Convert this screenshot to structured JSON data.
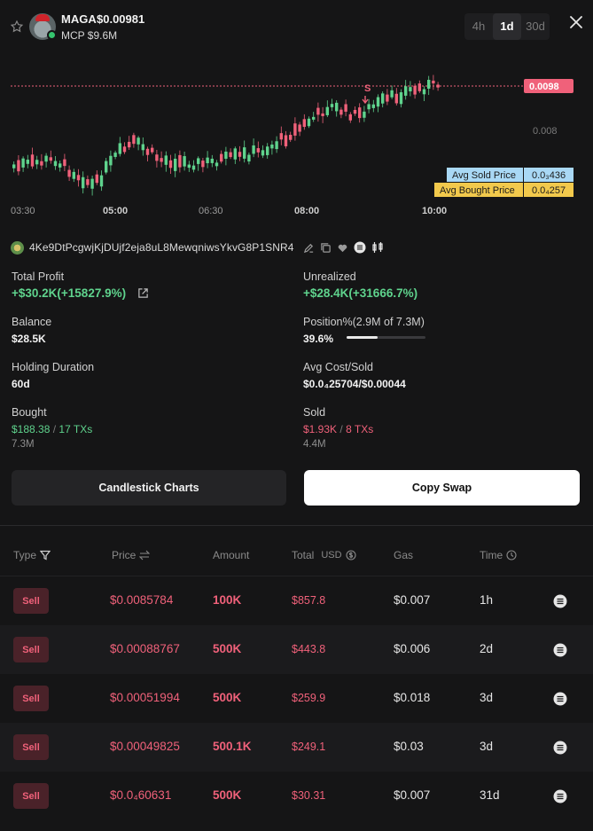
{
  "header": {
    "token_name": "MAGA",
    "token_price": "$0.00981",
    "mcp": "MCP $9.6M",
    "timeframes": [
      "4h",
      "1d",
      "30d"
    ],
    "active_timeframe": "1d"
  },
  "chart": {
    "price_tag": "0.0098",
    "axis_label": "0.008",
    "x_ticks": [
      "03:30",
      "05:00",
      "06:30",
      "08:00",
      "10:00"
    ],
    "marker_label": "S",
    "avg_sold_label": "Avg Sold Price",
    "avg_sold_value": "0.0₃436",
    "avg_bought_label": "Avg Bought Price",
    "avg_bought_value": "0.0₄257",
    "colors": {
      "up": "#5fd38d",
      "down": "#f0617a",
      "avg_sold_bg": "#a9d8f5",
      "avg_bought_bg": "#f2c94c",
      "price_line": "#f0617a"
    }
  },
  "wallet": {
    "address": "4Ke9DtPcgwjKjDUjf2eja8uL8MewqniwsYkvG8P1SNR4",
    "icons": [
      "edit-icon",
      "copy-icon",
      "heart-icon",
      "solscan-icon",
      "candles-icon"
    ]
  },
  "stats": {
    "total_profit_label": "Total Profit",
    "total_profit_value": "+$30.2K(+15827.9%)",
    "unrealized_label": "Unrealized",
    "unrealized_value": "+$28.4K(+31666.7%)",
    "balance_label": "Balance",
    "balance_value": "$28.5K",
    "position_label": "Position%(2.9M of 7.3M)",
    "position_value": "39.6%",
    "position_fraction": 0.396,
    "holding_label": "Holding Duration",
    "holding_value": "60d",
    "avg_cost_label": "Avg Cost/Sold",
    "avg_cost_value": "$0.0₄25704/$0.00044",
    "bought_label": "Bought",
    "bought_value": "$188.38",
    "bought_sep": "/",
    "bought_txs": "17 TXs",
    "bought_amount": "7.3M",
    "sold_label": "Sold",
    "sold_value": "$1.93K",
    "sold_sep": "/",
    "sold_txs": "8 TXs",
    "sold_amount": "4.4M"
  },
  "buttons": {
    "candlestick_label": "Candlestick Charts",
    "copy_swap_label": "Copy Swap"
  },
  "table": {
    "headers": {
      "type": "Type",
      "price": "Price",
      "amount": "Amount",
      "total": "Total",
      "total_unit": "USD",
      "gas": "Gas",
      "time": "Time"
    },
    "rows": [
      {
        "type": "Sell",
        "price": "$0.0085784",
        "amount": "100K",
        "total": "$857.8",
        "gas": "$0.007",
        "time": "1h"
      },
      {
        "type": "Sell",
        "price": "$0.00088767",
        "amount": "500K",
        "total": "$443.8",
        "gas": "$0.006",
        "time": "2d"
      },
      {
        "type": "Sell",
        "price": "$0.00051994",
        "amount": "500K",
        "total": "$259.9",
        "gas": "$0.018",
        "time": "3d"
      },
      {
        "type": "Sell",
        "price": "$0.00049825",
        "amount": "500.1K",
        "total": "$249.1",
        "gas": "$0.03",
        "time": "3d"
      },
      {
        "type": "Sell",
        "price": "$0.0₄60631",
        "amount": "500K",
        "total": "$30.31",
        "gas": "$0.007",
        "time": "31d"
      }
    ]
  }
}
